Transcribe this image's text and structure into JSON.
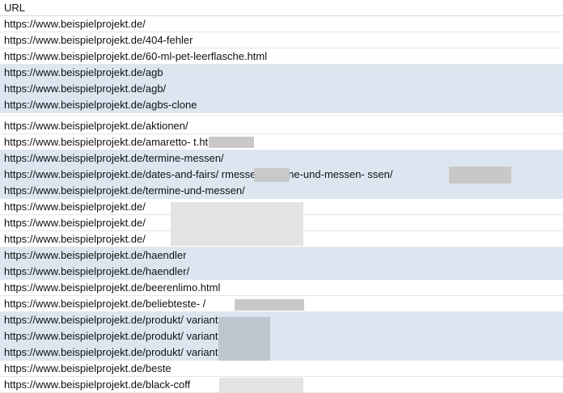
{
  "sheet": {
    "header": "URL",
    "rows": [
      "https://www.beispielprojekt.de/",
      "https://www.beispielprojekt.de/404-fehler",
      "https://www.beispielprojekt.de/60-ml-pet-leerflasche.html",
      "https://www.beispielprojekt.de/agb",
      "https://www.beispielprojekt.de/agb/",
      "https://www.beispielprojekt.de/agbs-clone",
      "https://www.beispielprojekt.de/aktionen/",
      "https://www.beispielprojekt.de/amaretto-                t.html",
      "https://www.beispielprojekt.de/termine-messen/",
      "https://www.beispielprojekt.de/dates-and-fairs/              rmessen/termine-und-messen-                          ssen/",
      "https://www.beispielprojekt.de/termine-und-messen/",
      "https://www.beispielprojekt.de/",
      "https://www.beispielprojekt.de/",
      "https://www.beispielprojekt.de/",
      "https://www.beispielprojekt.de/haendler",
      "https://www.beispielprojekt.de/haendler/",
      "https://www.beispielprojekt.de/beerenlimo.html",
      "https://www.beispielprojekt.de/beliebteste-                          /",
      "https://www.beispielprojekt.de/produkt/              varianten",
      "https://www.beispielprojekt.de/produkt/              varianten1",
      "https://www.beispielprojekt.de/produkt/              varianten-clone",
      "https://www.beispielprojekt.de/beste",
      "https://www.beispielprojekt.de/black-coff"
    ]
  }
}
